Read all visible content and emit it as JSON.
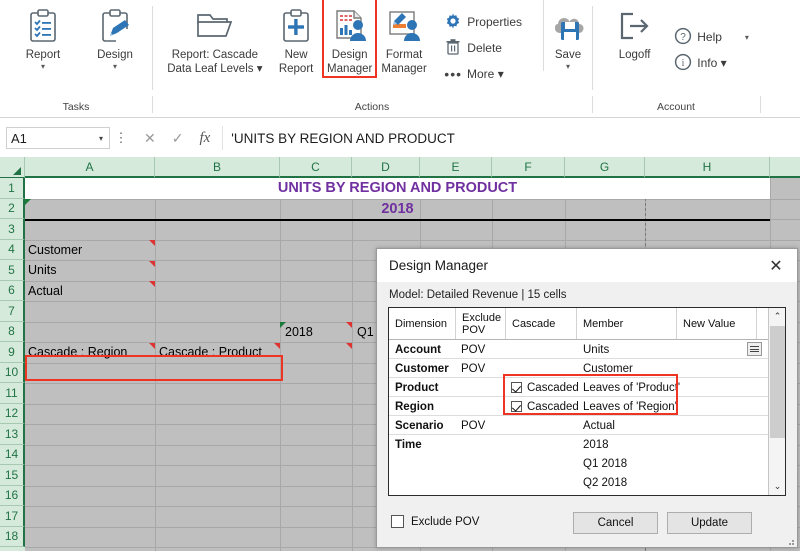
{
  "ribbon": {
    "groups": [
      {
        "label": "Tasks"
      },
      {
        "label": "Actions"
      },
      {
        "label": "Account"
      }
    ],
    "tasks": {
      "report": {
        "label": "Report",
        "icon": "clipboard-list-icon",
        "caret": "▾"
      },
      "design": {
        "label": "Design",
        "icon": "clipboard-pen-icon",
        "caret": "▾"
      }
    },
    "actions": {
      "report_cascade": {
        "line1": "Report: Cascade",
        "line2": "Data Leaf Levels ▾",
        "icon": "folder-open-icon"
      },
      "new_report": {
        "line1": "New",
        "line2": "Report",
        "icon": "clipboard-plus-icon"
      },
      "design_manager": {
        "line1": "Design",
        "line2": "Manager",
        "icon": "design-manager-icon",
        "highlighted": true
      },
      "format_manager": {
        "line1": "Format",
        "line2": "Manager",
        "icon": "format-manager-icon"
      },
      "properties": {
        "label": "Properties",
        "icon": "gear-icon"
      },
      "delete": {
        "label": "Delete",
        "icon": "trash-icon"
      },
      "more": {
        "label": "More ▾",
        "icon": "ellipsis-icon"
      },
      "save": {
        "label": "Save",
        "caret": "▾",
        "icon": "cloud-save-icon"
      }
    },
    "account": {
      "logoff": {
        "label": "Logoff",
        "icon": "logoff-icon"
      },
      "help": {
        "label": "Help",
        "icon": "question-circle-icon",
        "caret": "▾"
      },
      "info": {
        "label": "Info ▾",
        "icon": "info-circle-icon"
      }
    }
  },
  "formula_bar": {
    "name_box": "A1",
    "cancel_icon": "✕",
    "enter_icon": "✓",
    "fx_icon": "fx",
    "formula": "'UNITS BY REGION AND PRODUCT"
  },
  "grid": {
    "columns": [
      "A",
      "B",
      "C",
      "D",
      "E",
      "F",
      "G",
      "H"
    ],
    "rows": [
      "1",
      "2",
      "3",
      "4",
      "5",
      "6",
      "7",
      "8",
      "9",
      "10",
      "11",
      "12",
      "13",
      "14",
      "15",
      "16",
      "17",
      "18"
    ],
    "cells": {
      "title": "UNITS BY REGION AND PRODUCT",
      "subtitle": "2018",
      "a4": "Customer",
      "a5": "Units",
      "a6": "Actual",
      "c8": "2018",
      "d8": "Q1",
      "a9": "Cascade : Region",
      "b9": "Cascade : Product"
    }
  },
  "dialog": {
    "title": "Design Manager",
    "close_icon": "✕",
    "model_text": "Model: Detailed Revenue | 15 cells",
    "table": {
      "headers": [
        "Dimension",
        "Exclude POV",
        "Cascade",
        "Member",
        "New Value"
      ],
      "rows": [
        {
          "dimension": "Account",
          "exclude_pov": "POV",
          "cascade": "",
          "cascade_checked": false,
          "member": "Units",
          "new_value": "",
          "has_grip": true
        },
        {
          "dimension": "Customer",
          "exclude_pov": "POV",
          "cascade": "",
          "cascade_checked": false,
          "member": "Customer",
          "new_value": "",
          "has_grip": false
        },
        {
          "dimension": "Product",
          "exclude_pov": "",
          "cascade": "Cascaded",
          "cascade_checked": true,
          "member": "Leaves of 'Product'",
          "new_value": "",
          "has_grip": false
        },
        {
          "dimension": "Region",
          "exclude_pov": "",
          "cascade": "Cascaded",
          "cascade_checked": true,
          "member": "Leaves of 'Region'",
          "new_value": "",
          "has_grip": false
        },
        {
          "dimension": "Scenario",
          "exclude_pov": "POV",
          "cascade": "",
          "cascade_checked": false,
          "member": "Actual",
          "new_value": "",
          "has_grip": false
        },
        {
          "dimension": "Time",
          "exclude_pov": "",
          "cascade": "",
          "cascade_checked": false,
          "member": "2018",
          "new_value": "",
          "has_grip": false
        },
        {
          "dimension": "",
          "exclude_pov": "",
          "cascade": "",
          "cascade_checked": false,
          "member": "Q1 2018",
          "new_value": "",
          "has_grip": false
        },
        {
          "dimension": "",
          "exclude_pov": "",
          "cascade": "",
          "cascade_checked": false,
          "member": "Q2 2018",
          "new_value": "",
          "has_grip": false
        }
      ]
    },
    "scroll_up_icon": "⌃",
    "scroll_down_icon": "⌄",
    "exclude_pov_label": "Exclude POV",
    "exclude_pov_checked": false,
    "cancel_label": "Cancel",
    "update_label": "Update"
  },
  "colors": {
    "accent_purple": "#7030a0",
    "excel_green": "#217346",
    "annotation_red": "#ee3524",
    "office_blue": "#2e75b6"
  }
}
